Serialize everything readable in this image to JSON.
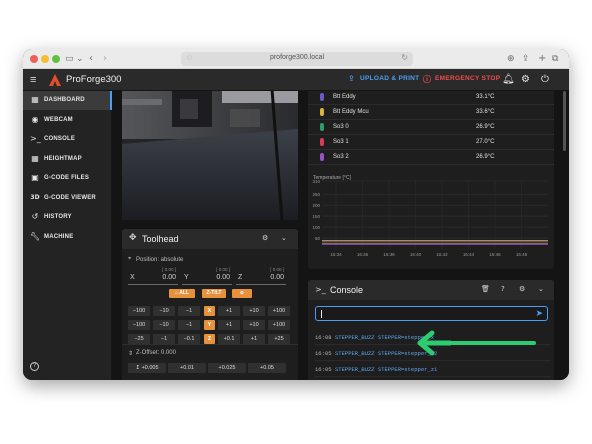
{
  "browser": {
    "url": "proforge300.local"
  },
  "app": {
    "title": "ProForge300",
    "upload_label": "UPLOAD & PRINT",
    "estop_label": "EMERGENCY STOP"
  },
  "sidebar": {
    "items": [
      {
        "label": "DASHBOARD",
        "icon": "dashboard-icon",
        "active": true
      },
      {
        "label": "WEBCAM",
        "icon": "webcam-icon"
      },
      {
        "label": "CONSOLE",
        "icon": "console-icon"
      },
      {
        "label": "HEIGHTMAP",
        "icon": "heightmap-icon"
      },
      {
        "label": "G-CODE FILES",
        "icon": "folder-icon"
      },
      {
        "label": "G-CODE VIEWER",
        "icon": "3d-icon",
        "glyph": "3D"
      },
      {
        "label": "HISTORY",
        "icon": "history-icon"
      },
      {
        "label": "MACHINE",
        "icon": "wrench-icon"
      }
    ]
  },
  "toolhead": {
    "title": "Toolhead",
    "position_label": "Position: absolute",
    "coords": [
      {
        "axis": "X",
        "sub": "[ 0.00 ]",
        "value": "0.00"
      },
      {
        "axis": "Y",
        "sub": "[ 0.00 ]",
        "value": "0.00"
      },
      {
        "axis": "Z",
        "sub": "[ 0.00 ]",
        "value": "0.00"
      }
    ],
    "home_all": "ALL",
    "z_tilt": "Z-TILT",
    "jog_rows": [
      {
        "left": [
          "−100",
          "−10",
          "−1"
        ],
        "axis": "X",
        "right": [
          "+1",
          "+10",
          "+100"
        ]
      },
      {
        "left": [
          "−100",
          "−10",
          "−1"
        ],
        "axis": "Y",
        "right": [
          "+1",
          "+10",
          "+100"
        ]
      },
      {
        "left": [
          "−25",
          "−1",
          "−0.1"
        ],
        "axis": "Z",
        "right": [
          "+0.1",
          "+1",
          "+25"
        ]
      }
    ],
    "zoffset_label": "Z-Offset: 0.000",
    "zoffset_steps": [
      "+0.005",
      "+0.01",
      "+0.025",
      "+0.05"
    ]
  },
  "temperatures": {
    "rows": [
      {
        "name": "Btt Eddy",
        "value": "33.1°C",
        "color": "#6a5acd"
      },
      {
        "name": "Btt Eddy Mcu",
        "value": "33.6°C",
        "color": "#d9b43c"
      },
      {
        "name": "So3 0",
        "value": "26.9°C",
        "color": "#2e9c6a"
      },
      {
        "name": "So3 1",
        "value": "27.0°C",
        "color": "#d83b5a"
      },
      {
        "name": "So3 2",
        "value": "26.9°C",
        "color": "#9b4fc9"
      }
    ],
    "chart_title": "Temperature [°C]",
    "y_ticks": [
      "310",
      "250",
      "200",
      "150",
      "100",
      "50"
    ],
    "x_ticks": [
      "16:34",
      "16:36",
      "16:38",
      "16:40",
      "16:42",
      "16:44",
      "16:46",
      "16:48"
    ],
    "series_colors": [
      "#6a5acd",
      "#d9b43c",
      "#2e9c6a",
      "#d83b5a",
      "#9b4fc9"
    ],
    "series_values": [
      33.1,
      33.6,
      26.9,
      27.0,
      26.9
    ]
  },
  "console": {
    "title": "Console",
    "lines": [
      {
        "time": "16:08",
        "cmd": "STEPPER_BUZZ STEPPER=stepper_x"
      },
      {
        "time": "16:05",
        "cmd": "STEPPER_BUZZ STEPPER=stepper_z2"
      },
      {
        "time": "16:05",
        "cmd": "STEPPER_BUZZ STEPPER=stepper_z1"
      }
    ]
  },
  "annotation": {
    "arrow_color": "#2ecc71"
  }
}
